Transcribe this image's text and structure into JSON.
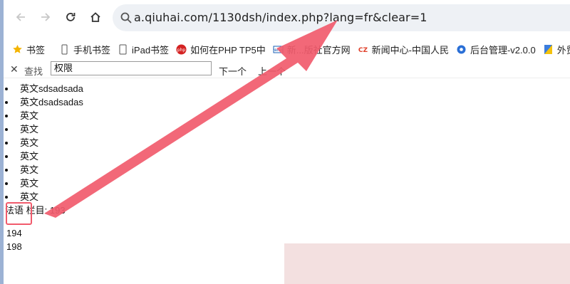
{
  "browser": {
    "url": "a.qiuhai.com/1130dsh/index.php?lang=fr&clear=1"
  },
  "bookmarks": [
    {
      "label": "书签",
      "icon": "star-icon"
    },
    {
      "label": "手机书签",
      "icon": "phone-icon"
    },
    {
      "label": "iPad书签",
      "icon": "tablet-icon"
    },
    {
      "label": "如何在PHP TP5中",
      "icon": "php-icon"
    },
    {
      "label": "新...版社官方网",
      "icon": "news-icon"
    },
    {
      "label": "新闻中心-中国人民",
      "icon": "cz-icon"
    },
    {
      "label": "后台管理-v2.0.0",
      "icon": "gear-icon"
    },
    {
      "label": "外贸",
      "icon": "page-icon"
    }
  ],
  "findbar": {
    "label": "查找",
    "query": "权限",
    "next_label": "下一个",
    "prev_label": "上一个"
  },
  "content": {
    "list_items": [
      "英文sdsadsada",
      "英文dsadsadas",
      "英文",
      "英文",
      "英文",
      "英文",
      "英文",
      "英文",
      "英文"
    ],
    "lang_label": "法语 栏目:",
    "lang_value": "193",
    "line2": "194",
    "line3": "198"
  },
  "colors": {
    "annotation": "#f15b6c",
    "pink_block": "#f3e0e0",
    "left_frame": "#9cb2d4"
  }
}
